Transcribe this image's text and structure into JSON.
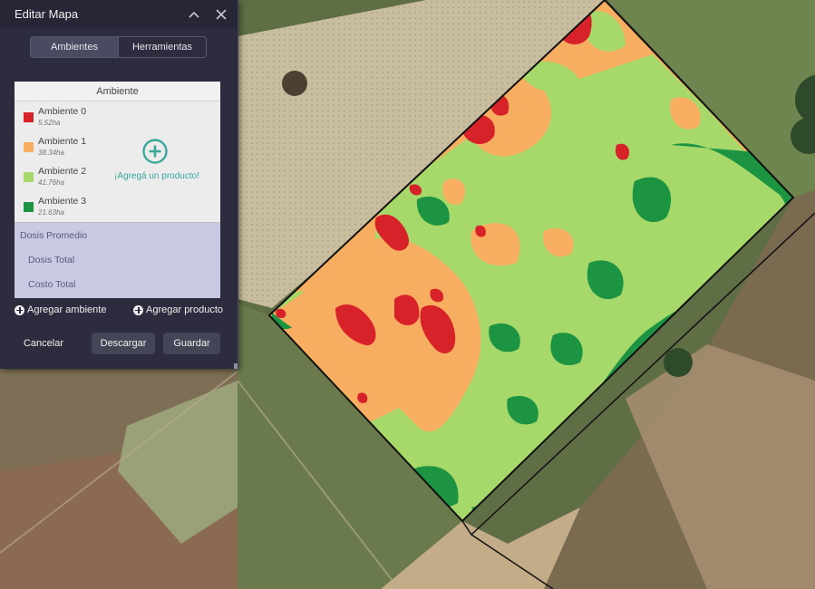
{
  "panel": {
    "title": "Editar Mapa",
    "tabs": [
      {
        "label": "Ambientes",
        "active": true
      },
      {
        "label": "Herramientas",
        "active": false
      }
    ],
    "table_header": "Ambiente",
    "ambientes": [
      {
        "name": "Ambiente 0",
        "area": "5.52ha",
        "color": "#d8222a"
      },
      {
        "name": "Ambiente 1",
        "area": "38.34ha",
        "color": "#f7ae60"
      },
      {
        "name": "Ambiente 2",
        "area": "41.76ha",
        "color": "#a6d96a"
      },
      {
        "name": "Ambiente 3",
        "area": "21.63ha",
        "color": "#1d9441"
      }
    ],
    "add_product_cta": "¡Agregá un producto!",
    "summary_rows": [
      "Dosis Promedio",
      "Dosis Total",
      "Costo Total"
    ],
    "add_ambiente": "Agregar ambiente",
    "add_producto": "Agregar producto",
    "cancel": "Cancelar",
    "download": "Descargar",
    "save": "Guardar"
  },
  "colors": {
    "panel_bg": "#2c2c3e",
    "accent": "#3aa89a",
    "summary_bg": "#c9c9e4"
  },
  "icons": {
    "minimize": "chevron-up-icon",
    "close": "close-icon",
    "add_product": "plus-circle-icon"
  }
}
